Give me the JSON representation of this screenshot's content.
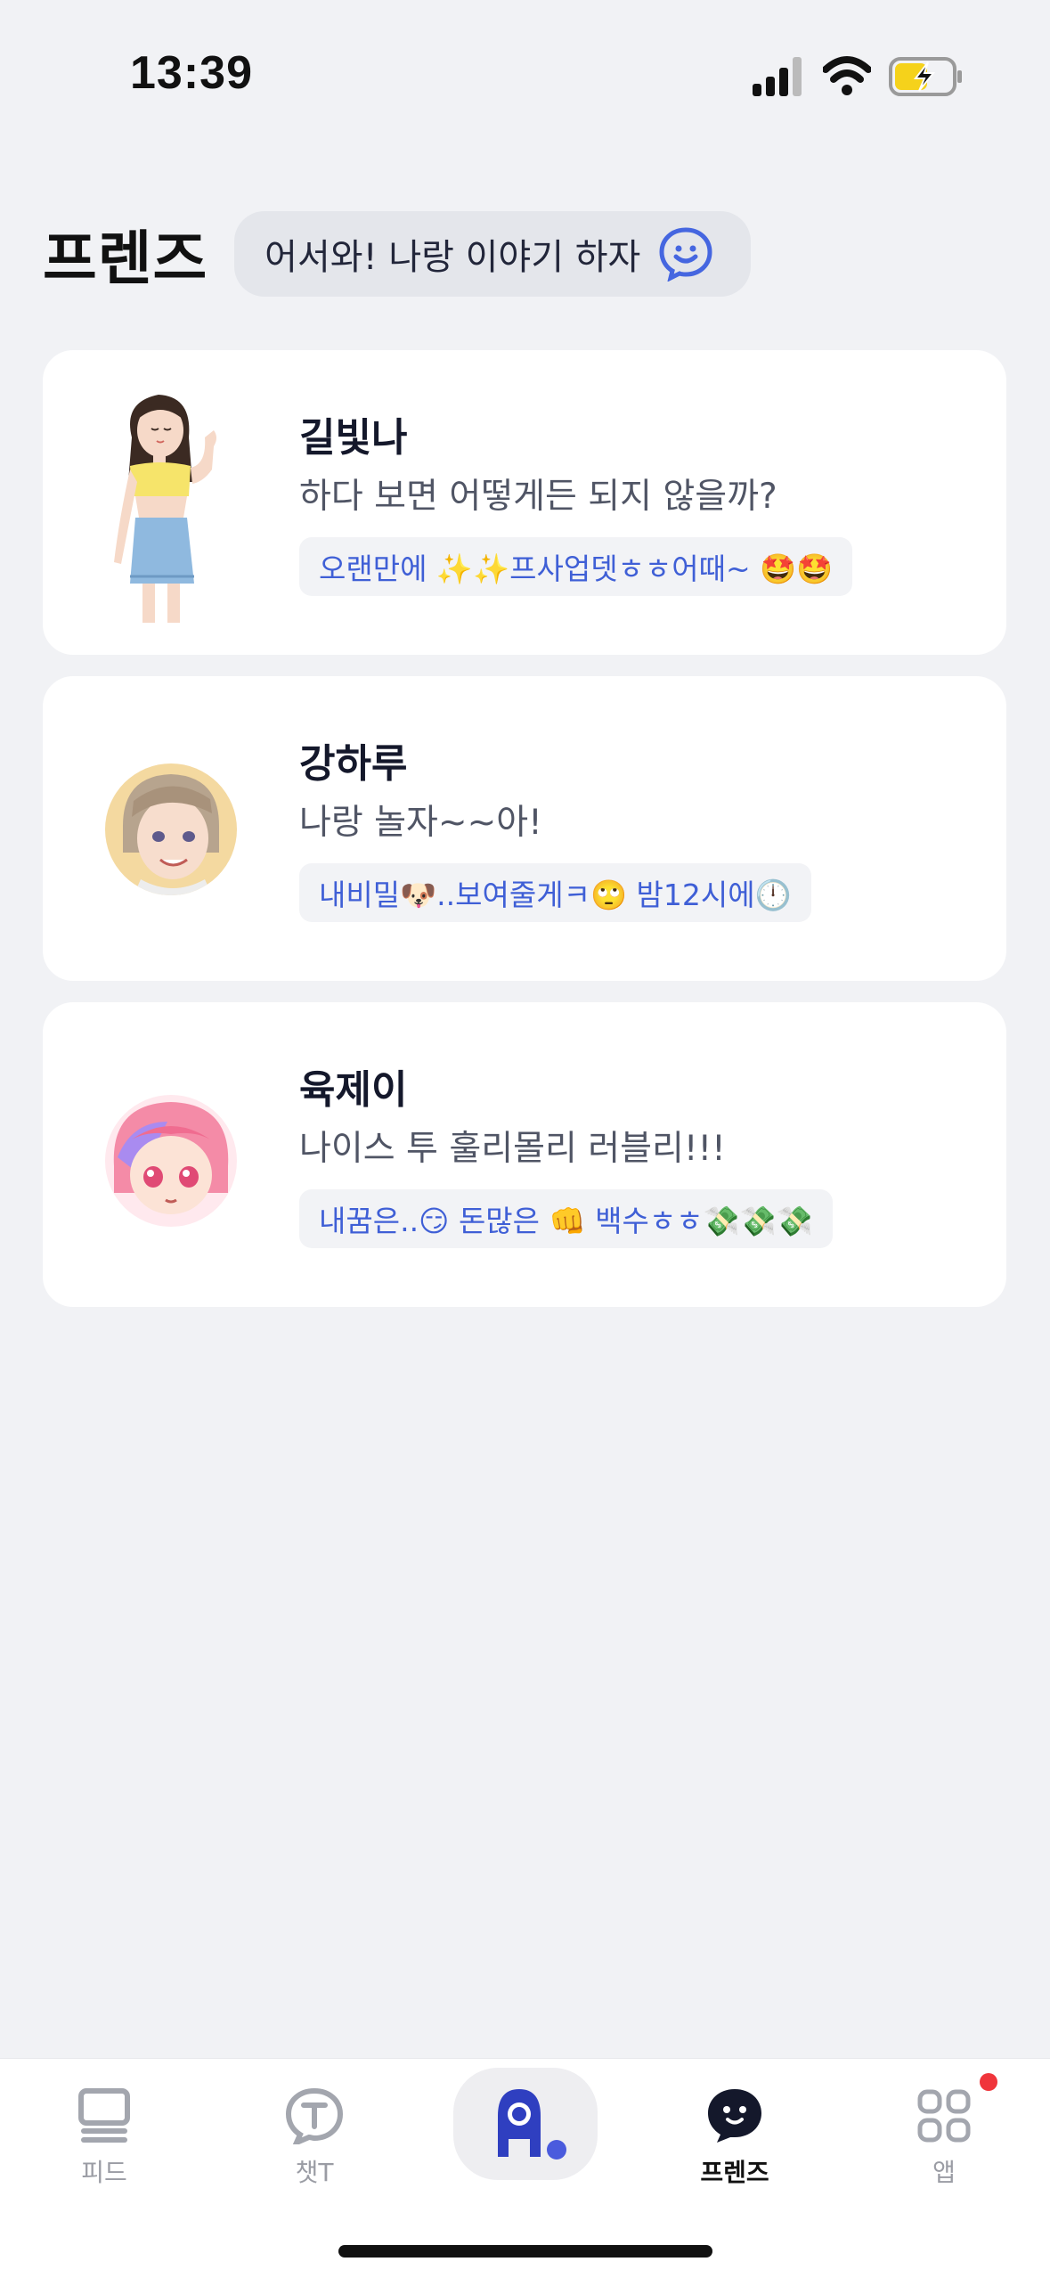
{
  "status_bar": {
    "time": "13:39"
  },
  "header": {
    "title": "프렌즈",
    "greeting": "어서와! 나랑 이야기 하자"
  },
  "friends": [
    {
      "name": "길빛나",
      "status": "하다 보면 어떻게든 되지 않을까?",
      "tag": "오랜만에 ✨✨프사업뎃ㅎㅎ어때~ 🤩🤩"
    },
    {
      "name": "강하루",
      "status": "나랑 놀자~~아!",
      "tag": "내비밀🐶..보여줄게ㅋ🙄 밤12시에🕛"
    },
    {
      "name": "육제이",
      "status": "나이스 투 훌리몰리 러블리!!!",
      "tag": "내꿈은..😏 돈많은 👊 백수ㅎㅎ💸💸💸"
    }
  ],
  "nav": {
    "feed": "피드",
    "chat": "챗T",
    "friends": "프렌즈",
    "apps": "앱",
    "active": "friends"
  },
  "colors": {
    "background": "#F1F2F5",
    "accent": "#3F5FD6",
    "dark": "#14182B",
    "badge": "#F0353B"
  }
}
